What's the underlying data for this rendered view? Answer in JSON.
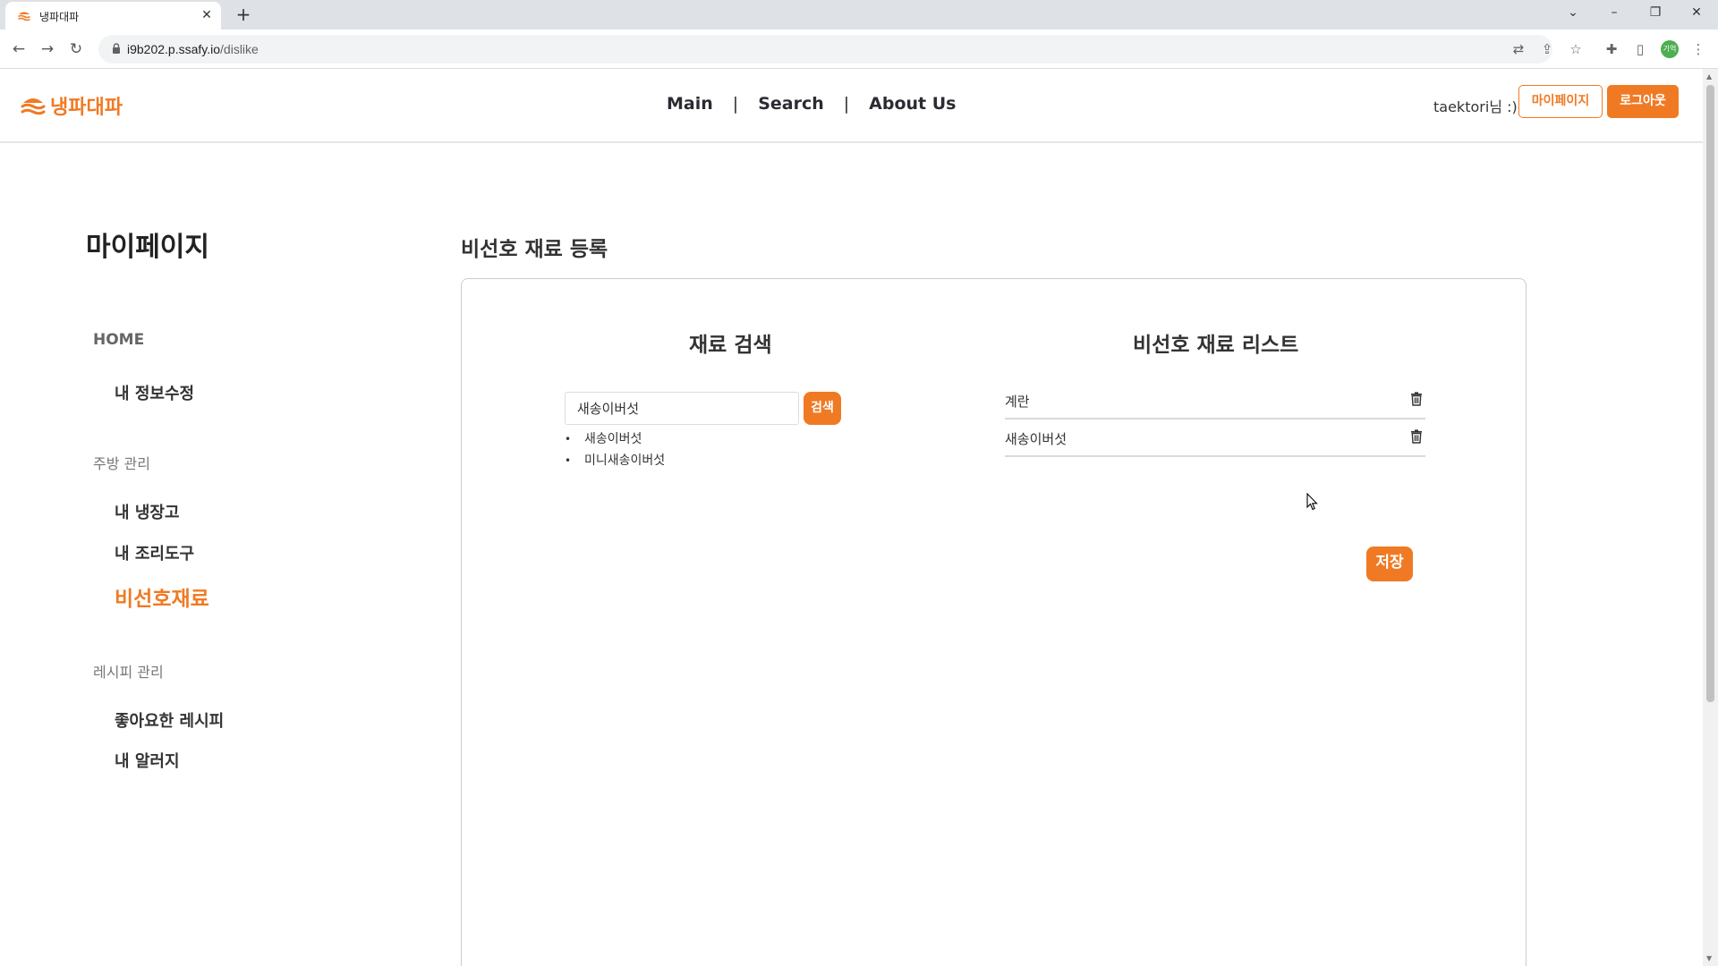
{
  "browser": {
    "tab_title": "냉파대파",
    "tab_close": "✕",
    "new_tab": "+",
    "url_host": "i9b202.p.ssafy.io",
    "url_path": "/dislike",
    "profile_initials": "기억"
  },
  "header": {
    "logo_text": "냉파대파",
    "nav": [
      {
        "label": "Main"
      },
      {
        "label": "Search"
      },
      {
        "label": "About Us"
      }
    ],
    "nav_separator": "|",
    "greeting": "taektori님 :)",
    "mypage_button": "마이페이지",
    "logout_button": "로그아웃"
  },
  "sidebar": {
    "title": "마이페이지",
    "home": "HOME",
    "profile_edit": "내 정보수정",
    "kitchen_section": "주방 관리",
    "fridge": "내 냉장고",
    "tools": "내 조리도구",
    "dislike": "비선호재료",
    "recipe_section": "레시피 관리",
    "liked_recipes": "좋아요한 레시피",
    "allergy": "내 알러지"
  },
  "main": {
    "title": "비선호 재료 등록",
    "search_column_title": "재료 검색",
    "search_value": "새송이버섯",
    "search_button": "검색",
    "search_results": [
      "새송이버섯",
      "미니새송이버섯"
    ],
    "list_column_title": "비선호 재료 리스트",
    "dislike_items": [
      "계란",
      "새송이버섯"
    ],
    "save_button": "저장"
  },
  "colors": {
    "accent": "#f07a24",
    "text": "#333333",
    "border": "#cccccc"
  }
}
